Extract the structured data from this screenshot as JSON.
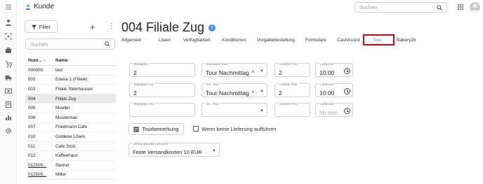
{
  "app": {
    "title": "Kunde"
  },
  "search_top": {
    "placeholder": "Suchen"
  },
  "left": {
    "filter_label": "Filter",
    "search_placeholder": "Suchen",
    "columns": {
      "num": "Num...",
      "name": "Name"
    },
    "rows": [
      {
        "num": "000000",
        "name": "test"
      },
      {
        "num": "002",
        "name": "Edeka 1 (Filiale)"
      },
      {
        "num": "003",
        "name": "Filiale Steinhausen"
      },
      {
        "num": "004",
        "name": "Filiale Zug",
        "selected": true
      },
      {
        "num": "005",
        "name": "Mueller"
      },
      {
        "num": "006",
        "name": "Musterman"
      },
      {
        "num": "007",
        "name": "Friedmann Cafe"
      },
      {
        "num": "010",
        "name": "Goldene Löwin"
      },
      {
        "num": "011",
        "name": "Cafe Stolz"
      },
      {
        "num": "012",
        "name": "Kaffeehaus"
      },
      {
        "num": "012509...",
        "name": "Steiner"
      },
      {
        "num": "012509...",
        "name": "Miller"
      }
    ]
  },
  "main": {
    "title": "004 Filiale Zug",
    "tabs": [
      "Allgemein",
      "Listen",
      "Verfügbarkeit",
      "Konditionen",
      "Vorgabebestellung",
      "Formulare",
      "CashAssist",
      "Tour",
      "Bakery2b"
    ],
    "active_tab": "Tour",
    "rows": [
      {
        "rp_label": "Rüstplatz",
        "rp_value": "2",
        "tour_label": "Standard Tour",
        "tour_value": "Tour Nachmittag",
        "pos_label": "Anfahrt Pos.",
        "pos_value": "2",
        "lz_label": "Lieferzeit",
        "lz_value": "10:00"
      },
      {
        "rp_label": "Rüstplatz Sa",
        "rp_value": "2",
        "tour_label": "Sa. Tour",
        "tour_value": "Tour Nachmittag",
        "pos_label": "Anfahrt Pos.",
        "pos_value": "2",
        "lz_label": "Lieferzeit",
        "lz_value": "10:00"
      },
      {
        "rp_label": "Rüstplatz So.",
        "rp_value": "",
        "tour_label": "So. Tour",
        "tour_value": "",
        "pos_label": "Anfahrt Pos.",
        "pos_value": "",
        "lz_label": "Lieferzeit",
        "lz_value": "hh:mm"
      }
    ],
    "tourbemerkung_label": "Tourbemerkung",
    "no_delivery_label": "Wenn keine Lieferung aufführen",
    "versand": {
      "label": "Versandkosten Bereich",
      "value": "Feste Versandkosten 10 EUR"
    }
  },
  "colors": {
    "accent": "#4a90e2",
    "highlight": "#d0021b"
  }
}
